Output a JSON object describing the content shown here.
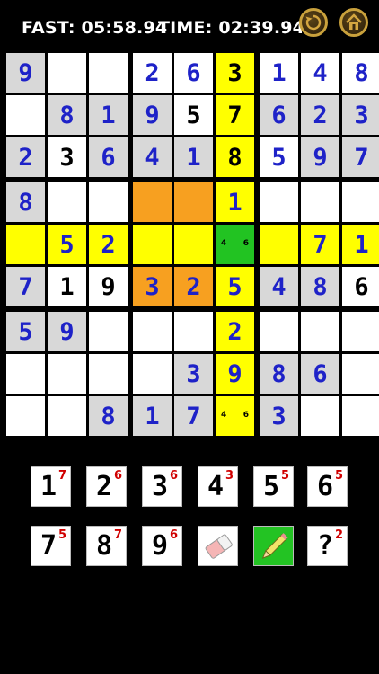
{
  "header": {
    "fast_label": "FAST:",
    "fast_value": "05:58.94",
    "time_label": "TIME:",
    "time_value": "02:39.94",
    "undo_icon": "undo-icon",
    "home_icon": "home-icon"
  },
  "colors": {
    "given_digit": "#1e22c8",
    "entered_digit": "#000000",
    "highlight_yellow": "#ffff00",
    "highlight_orange": "#f7a020",
    "selected_green": "#22c322",
    "cell_white": "#ffffff",
    "cell_gray": "#d8d8d8",
    "note_red": "#d00000"
  },
  "grid": [
    [
      {
        "v": "9",
        "t": "g"
      },
      {
        "v": "",
        "t": "e"
      },
      {
        "v": "",
        "t": "e"
      },
      {
        "v": "2",
        "t": "g"
      },
      {
        "v": "6",
        "t": "g"
      },
      {
        "v": "3",
        "t": "u"
      },
      {
        "v": "1",
        "t": "g"
      },
      {
        "v": "4",
        "t": "g"
      },
      {
        "v": "8",
        "t": "g"
      }
    ],
    [
      {
        "v": "",
        "t": "e"
      },
      {
        "v": "8",
        "t": "g"
      },
      {
        "v": "1",
        "t": "g"
      },
      {
        "v": "9",
        "t": "g"
      },
      {
        "v": "5",
        "t": "u"
      },
      {
        "v": "7",
        "t": "u"
      },
      {
        "v": "6",
        "t": "g"
      },
      {
        "v": "2",
        "t": "g"
      },
      {
        "v": "3",
        "t": "g"
      }
    ],
    [
      {
        "v": "2",
        "t": "g"
      },
      {
        "v": "3",
        "t": "u"
      },
      {
        "v": "6",
        "t": "g"
      },
      {
        "v": "4",
        "t": "g"
      },
      {
        "v": "1",
        "t": "g"
      },
      {
        "v": "8",
        "t": "u"
      },
      {
        "v": "5",
        "t": "g"
      },
      {
        "v": "9",
        "t": "g"
      },
      {
        "v": "7",
        "t": "g"
      }
    ],
    [
      {
        "v": "8",
        "t": "g"
      },
      {
        "v": "",
        "t": "e"
      },
      {
        "v": "",
        "t": "e"
      },
      {
        "v": "",
        "t": "e"
      },
      {
        "v": "",
        "t": "e"
      },
      {
        "v": "1",
        "t": "g"
      },
      {
        "v": "",
        "t": "e"
      },
      {
        "v": "",
        "t": "e"
      },
      {
        "v": "",
        "t": "e"
      }
    ],
    [
      {
        "v": "",
        "t": "e"
      },
      {
        "v": "5",
        "t": "g"
      },
      {
        "v": "2",
        "t": "g"
      },
      {
        "v": "",
        "t": "e"
      },
      {
        "v": "",
        "t": "e"
      },
      {
        "v": "",
        "t": "n",
        "notes": [
          "4",
          "6"
        ]
      },
      {
        "v": "",
        "t": "e"
      },
      {
        "v": "7",
        "t": "g"
      },
      {
        "v": "1",
        "t": "g"
      }
    ],
    [
      {
        "v": "7",
        "t": "g"
      },
      {
        "v": "1",
        "t": "u"
      },
      {
        "v": "9",
        "t": "u"
      },
      {
        "v": "3",
        "t": "g"
      },
      {
        "v": "2",
        "t": "g"
      },
      {
        "v": "5",
        "t": "g"
      },
      {
        "v": "4",
        "t": "g"
      },
      {
        "v": "8",
        "t": "g"
      },
      {
        "v": "6",
        "t": "u"
      }
    ],
    [
      {
        "v": "5",
        "t": "g"
      },
      {
        "v": "9",
        "t": "g"
      },
      {
        "v": "",
        "t": "e"
      },
      {
        "v": "",
        "t": "e"
      },
      {
        "v": "",
        "t": "e"
      },
      {
        "v": "2",
        "t": "g"
      },
      {
        "v": "",
        "t": "e"
      },
      {
        "v": "",
        "t": "e"
      },
      {
        "v": "",
        "t": "e"
      }
    ],
    [
      {
        "v": "",
        "t": "e"
      },
      {
        "v": "",
        "t": "e"
      },
      {
        "v": "",
        "t": "e"
      },
      {
        "v": "",
        "t": "e"
      },
      {
        "v": "3",
        "t": "g"
      },
      {
        "v": "9",
        "t": "g"
      },
      {
        "v": "8",
        "t": "g"
      },
      {
        "v": "6",
        "t": "g"
      },
      {
        "v": "",
        "t": "e"
      }
    ],
    [
      {
        "v": "",
        "t": "e"
      },
      {
        "v": "",
        "t": "e"
      },
      {
        "v": "8",
        "t": "g"
      },
      {
        "v": "1",
        "t": "g"
      },
      {
        "v": "7",
        "t": "g"
      },
      {
        "v": "",
        "t": "n",
        "notes": [
          "4",
          "6"
        ]
      },
      {
        "v": "3",
        "t": "g"
      },
      {
        "v": "",
        "t": "e"
      },
      {
        "v": "",
        "t": "e"
      }
    ]
  ],
  "cell_bg": [
    [
      "G",
      "W",
      "W",
      "W",
      "W",
      "Y",
      "W",
      "W",
      "W"
    ],
    [
      "W",
      "G",
      "G",
      "G",
      "W",
      "Y",
      "G",
      "G",
      "G"
    ],
    [
      "G",
      "W",
      "G",
      "G",
      "G",
      "Y",
      "W",
      "G",
      "G"
    ],
    [
      "G",
      "W",
      "W",
      "O",
      "O",
      "Y",
      "W",
      "W",
      "W"
    ],
    [
      "Y",
      "Y",
      "Y",
      "Y",
      "Y",
      "S",
      "Y",
      "Y",
      "Y"
    ],
    [
      "G",
      "W",
      "W",
      "O",
      "O",
      "Y",
      "G",
      "G",
      "W"
    ],
    [
      "G",
      "G",
      "W",
      "W",
      "W",
      "Y",
      "W",
      "W",
      "W"
    ],
    [
      "W",
      "W",
      "W",
      "W",
      "G",
      "Y",
      "G",
      "G",
      "W"
    ],
    [
      "W",
      "W",
      "G",
      "G",
      "G",
      "Y",
      "G",
      "W",
      "W"
    ]
  ],
  "keypad": [
    {
      "num": "1",
      "count": "7",
      "icon": ""
    },
    {
      "num": "2",
      "count": "6",
      "icon": ""
    },
    {
      "num": "3",
      "count": "6",
      "icon": ""
    },
    {
      "num": "4",
      "count": "3",
      "icon": ""
    },
    {
      "num": "5",
      "count": "5",
      "icon": ""
    },
    {
      "num": "6",
      "count": "5",
      "icon": ""
    },
    {
      "num": "7",
      "count": "5",
      "icon": ""
    },
    {
      "num": "8",
      "count": "7",
      "icon": ""
    },
    {
      "num": "9",
      "count": "6",
      "icon": ""
    },
    {
      "num": "",
      "count": "",
      "icon": "eraser-icon"
    },
    {
      "num": "",
      "count": "",
      "icon": "pencil-icon"
    },
    {
      "num": "?",
      "count": "2",
      "icon": ""
    }
  ]
}
